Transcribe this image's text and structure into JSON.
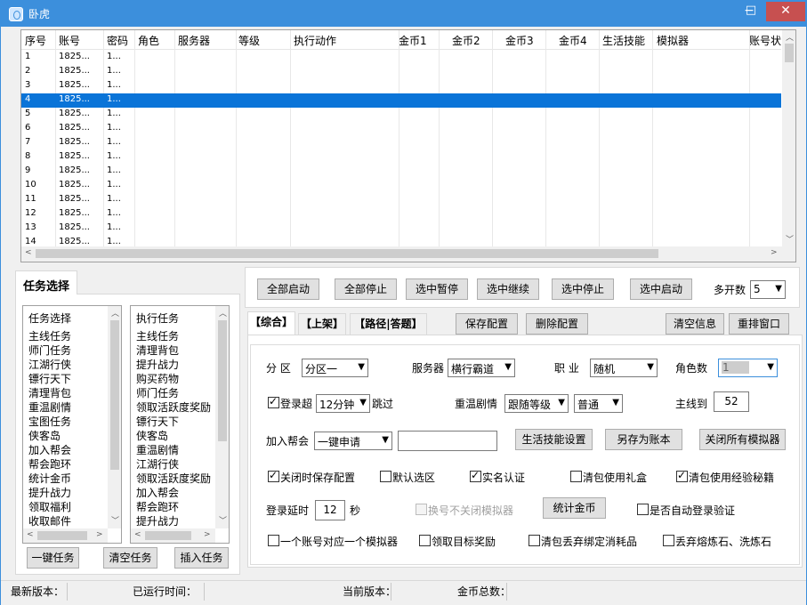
{
  "window": {
    "title": "卧虎",
    "min": "−",
    "max": "□",
    "close": "✕"
  },
  "grid": {
    "columns": [
      "序号",
      "账号",
      "密码",
      "角色",
      "服务器",
      "等级",
      "执行动作",
      "金币1",
      "金币2",
      "金币3",
      "金币4",
      "生活技能",
      "模拟器",
      "账号状"
    ],
    "rows": [
      [
        "1",
        "1825...",
        "1..."
      ],
      [
        "2",
        "1825...",
        "1..."
      ],
      [
        "3",
        "1825...",
        "1..."
      ],
      [
        "4",
        "1825...",
        "1..."
      ],
      [
        "5",
        "1825...",
        "1..."
      ],
      [
        "6",
        "1825...",
        "1..."
      ],
      [
        "7",
        "1825...",
        "1..."
      ],
      [
        "8",
        "1825...",
        "1..."
      ],
      [
        "9",
        "1825...",
        "1..."
      ],
      [
        "10",
        "1825...",
        "1..."
      ],
      [
        "11",
        "1825...",
        "1..."
      ],
      [
        "12",
        "1825...",
        "1..."
      ],
      [
        "13",
        "1825...",
        "1..."
      ],
      [
        "14",
        "1825...",
        "1..."
      ]
    ],
    "selected_row": 4
  },
  "task_panel": {
    "tab": "任务选择",
    "left_list_header": "任务选择",
    "left_items": [
      "主线任务",
      "师门任务",
      "江湖行侠",
      "镖行天下",
      "清理背包",
      "重温剧情",
      "宝图任务",
      "侠客岛",
      "加入帮会",
      "帮会跑环",
      "统计金币",
      "提升战力",
      "领取福利",
      "收取邮件"
    ],
    "right_list_header": "执行任务",
    "right_items": [
      "主线任务",
      "清理背包",
      "提升战力",
      "购买药物",
      "师门任务",
      "领取活跃度奖励",
      "镖行天下",
      "侠客岛",
      "重温剧情",
      "江湖行侠",
      "领取活跃度奖励",
      "加入帮会",
      "帮会跑环",
      "提升战力"
    ],
    "btn_onekey": "一键任务",
    "btn_clear": "清空任务",
    "btn_insert": "插入任务"
  },
  "toolbar": {
    "start_all": "全部启动",
    "stop_all": "全部停止",
    "pause_sel": "选中暂停",
    "resume_sel": "选中继续",
    "stop_sel": "选中停止",
    "start_sel": "选中启动",
    "multi_label": "多开数",
    "multi_value": "5"
  },
  "tabs": {
    "general": "【综合】",
    "shelf": "【上架】",
    "path": "【路径|答题】"
  },
  "tab_actions": {
    "save": "保存配置",
    "delete": "删除配置",
    "clear_info": "清空信息",
    "rearrange": "重排窗口"
  },
  "settings": {
    "zone_label": "分 区",
    "zone_value": "分区一",
    "server_label": "服务器",
    "server_value": "横行霸道",
    "job_label": "职 业",
    "job_value": "随机",
    "role_count_label": "角色数",
    "role_count_value": "1",
    "login_over_label": "登录超",
    "login_over_value": "12分钟",
    "skip_label": "跳过",
    "replay_label": "重温剧情",
    "replay_value": "跟随等级",
    "replay_mode": "普通",
    "mainline_label": "主线到",
    "mainline_value": "52",
    "join_guild_label": "加入帮会",
    "join_guild_value": "一键申请",
    "life_skill_btn": "生活技能设置",
    "save_as_btn": "另存为账本",
    "close_sims_btn": "关闭所有模拟器",
    "chk_close_save": "关闭时保存配置",
    "chk_default_zone": "默认选区",
    "chk_realname": "实名认证",
    "chk_gift": "清包使用礼盒",
    "chk_exp_book": "清包使用经验秘籍",
    "login_delay_label": "登录延时",
    "login_delay_value": "12",
    "seconds": "秒",
    "chk_no_close_sim": "换号不关闭模拟器",
    "stat_gold_btn": "统计金币",
    "chk_auto_verify": "是否自动登录验证",
    "chk_one_sim": "一个账号对应一个模拟器",
    "chk_target_reward": "领取目标奖励",
    "chk_drop_consumables": "清包丢弃绑定消耗品",
    "chk_drop_stones": "丢弃熔炼石、洗炼石"
  },
  "status": {
    "latest": "最新版本：",
    "runtime": "已运行时间：",
    "current": "当前版本：",
    "gold_total": "金币总数："
  }
}
